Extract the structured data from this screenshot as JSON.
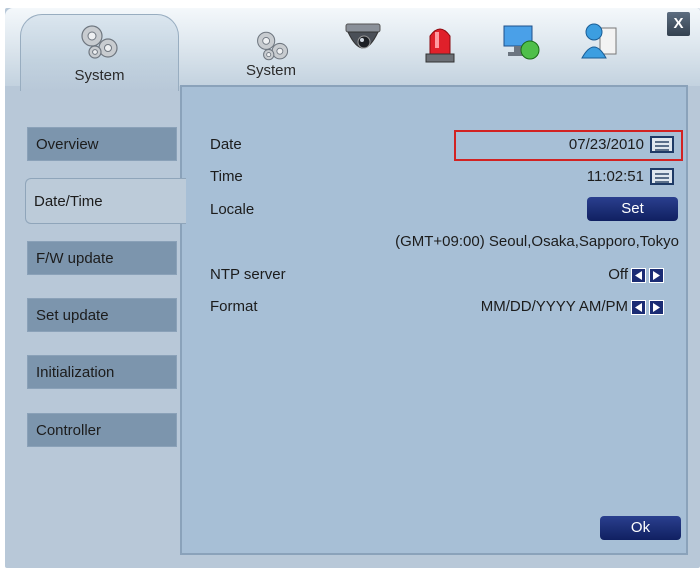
{
  "window": {
    "close_label": "X"
  },
  "header": {
    "active_tab_label": "System",
    "toolbar_label": "System",
    "icons": [
      "gear-icon",
      "camera-icon",
      "alarm-icon",
      "network-icon",
      "user-icon"
    ]
  },
  "sidebar": {
    "items": [
      {
        "label": "Overview"
      },
      {
        "label": "Date/Time",
        "active": true
      },
      {
        "label": "F/W update"
      },
      {
        "label": "Set update"
      },
      {
        "label": "Initialization"
      },
      {
        "label": "Controller"
      }
    ]
  },
  "datetime": {
    "date_label": "Date",
    "date_value": "07/23/2010",
    "time_label": "Time",
    "time_value": "11:02:51",
    "locale_label": "Locale",
    "locale_button": "Set",
    "timezone": "(GMT+09:00) Seoul,Osaka,Sapporo,Tokyo",
    "ntp_label": "NTP server",
    "ntp_value": "Off",
    "format_label": "Format",
    "format_value": "MM/DD/YYYY AM/PM"
  },
  "footer": {
    "ok_label": "Ok"
  },
  "colors": {
    "accent": "#1b2c74",
    "highlight_border": "#d22222",
    "panel": "#a7bfd6"
  }
}
